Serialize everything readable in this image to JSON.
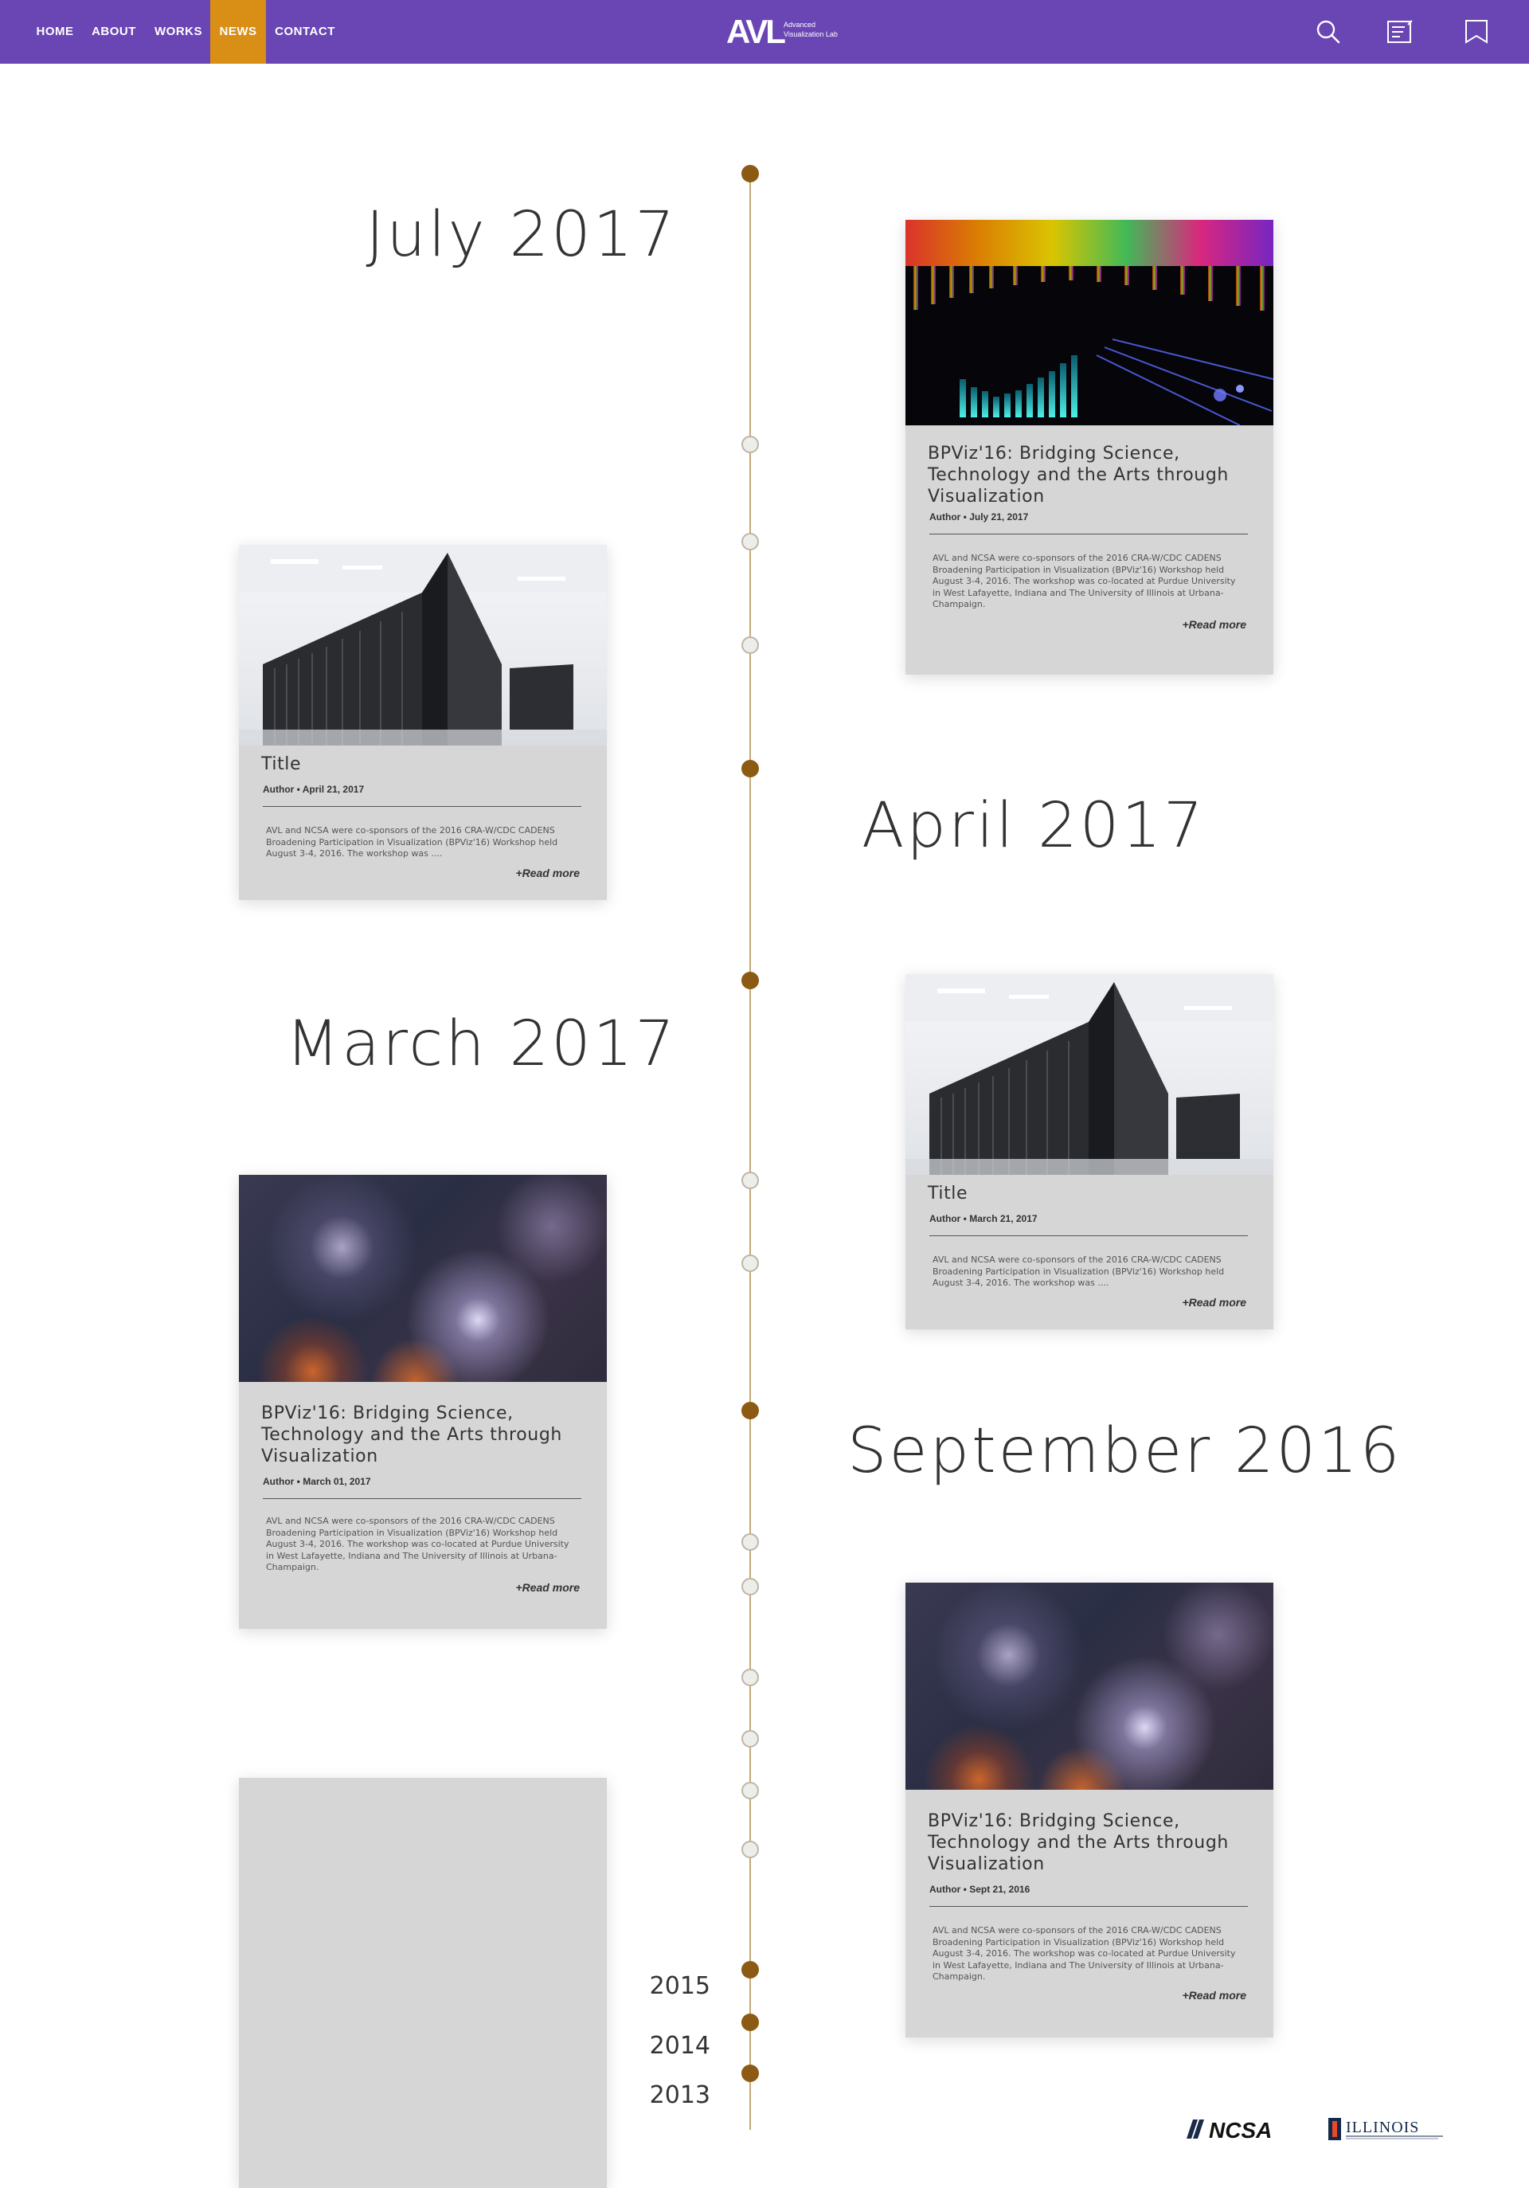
{
  "nav": {
    "items": [
      {
        "label": "HOME"
      },
      {
        "label": "ABOUT"
      },
      {
        "label": "WORKS"
      },
      {
        "label": "NEWS",
        "active": true
      },
      {
        "label": "CONTACT"
      }
    ],
    "logo_mark": "AVL",
    "logo_sub": "Advanced Visualization Lab",
    "icons": [
      "search-icon",
      "notes-icon",
      "bookmark-icon"
    ],
    "bg_color": "#6a45b4",
    "active_color": "#d98e16"
  },
  "timeline": {
    "months": [
      "July 2017",
      "April 2017",
      "March 2017",
      "September 2016"
    ],
    "years": [
      "2015",
      "2014",
      "2013"
    ],
    "line_color": "#c4a977",
    "dot_color": "#8c5a12"
  },
  "cards": [
    {
      "image": "light-rays",
      "title": "BPViz'16: Bridging Science, Technology and the Arts through Visualization",
      "meta": "Author • July 21, 2017",
      "excerpt": "AVL and NCSA were co-sponsors of the 2016 CRA-W/CDC CADENS Broadening Participation in Visualization (BPViz'16) Workshop held August 3-4, 2016. The workshop was co-located at Purdue University in West Lafayette, Indiana and The University of Illinois at Urbana-Champaign.",
      "more": "+Read more"
    },
    {
      "image": "supercomputer",
      "title": "Title",
      "meta": "Author • April 21, 2017",
      "excerpt": "AVL and NCSA were co-sponsors of the 2016 CRA-W/CDC CADENS Broadening Participation in Visualization (BPViz'16) Workshop held August 3-4, 2016. The workshop was ....",
      "more": "+Read more"
    },
    {
      "image": "supercomputer",
      "title": "Title",
      "meta": "Author • March 21, 2017",
      "excerpt": "AVL and NCSA were co-sponsors of the 2016 CRA-W/CDC CADENS Broadening Participation in Visualization (BPViz'16) Workshop held August 3-4, 2016. The workshop was ....",
      "more": "+Read more"
    },
    {
      "image": "galaxy",
      "title": "BPViz'16: Bridging Science, Technology and the Arts through Visualization",
      "meta": "Author • March 01, 2017",
      "excerpt": "AVL and NCSA were co-sponsors of the 2016 CRA-W/CDC CADENS Broadening Participation in Visualization (BPViz'16) Workshop held August 3-4, 2016. The workshop was co-located at Purdue University in West Lafayette, Indiana and The University of Illinois at Urbana-Champaign.",
      "more": "+Read more"
    },
    {
      "image": "galaxy",
      "title": "BPViz'16: Bridging Science, Technology and the Arts through Visualization",
      "meta": "Author • Sept 21, 2016",
      "excerpt": "AVL and NCSA were co-sponsors of the 2016 CRA-W/CDC CADENS Broadening Participation in Visualization (BPViz'16) Workshop held August 3-4, 2016. The workshop was co-located at Purdue University in West Lafayette, Indiana and The University of Illinois at Urbana-Champaign.",
      "more": "+Read more"
    }
  ],
  "footer": {
    "logos": [
      "NCSA",
      "ILLINOIS"
    ]
  }
}
